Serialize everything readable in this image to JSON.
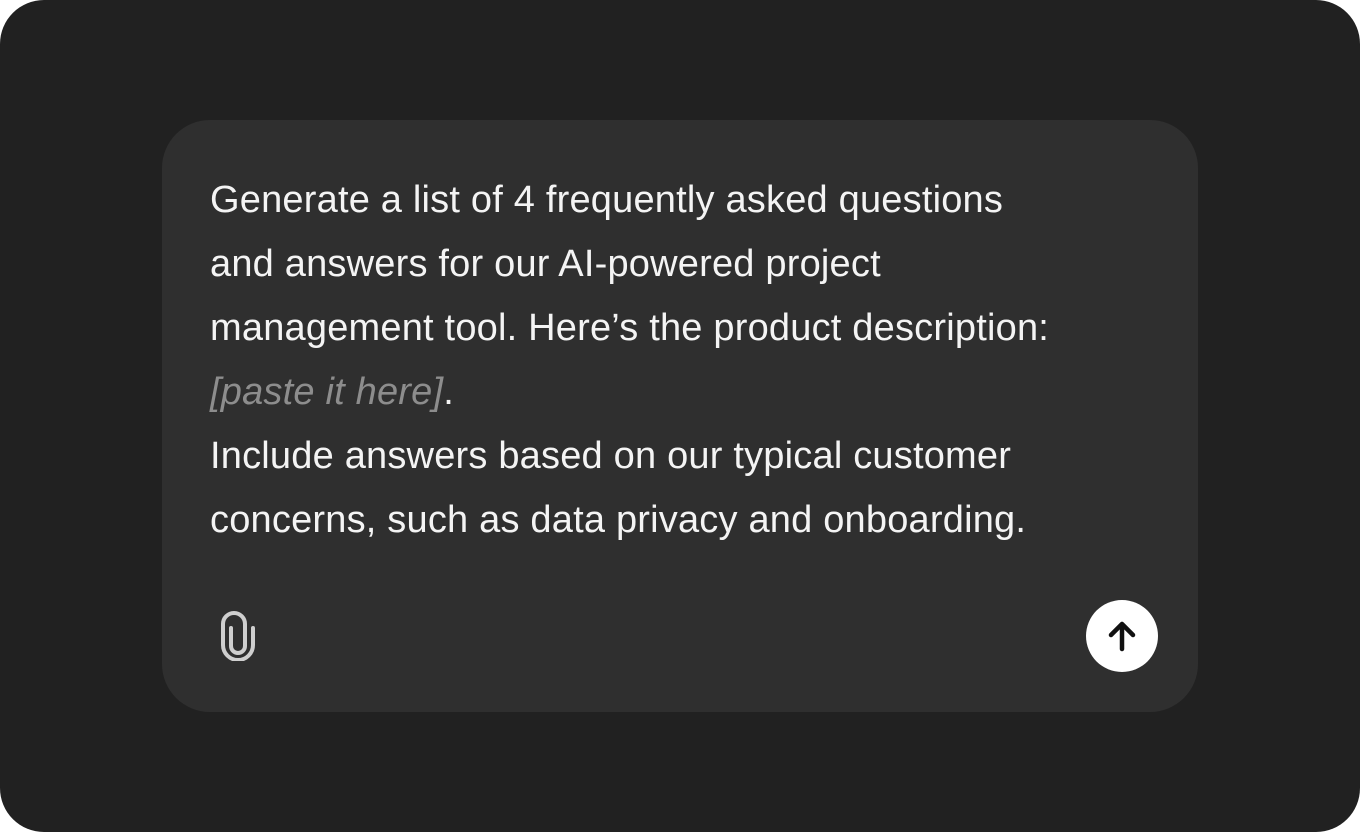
{
  "composer": {
    "prompt": {
      "line1": "Generate a list of 4 frequently asked questions",
      "line2": "and answers for our AI-powered project",
      "line3": "management tool. Here’s the product description:",
      "placeholder": "[paste it here]",
      "placeholder_suffix": ".",
      "line5": "Include answers based on our typical customer",
      "line6": "concerns, such as data privacy and onboarding."
    },
    "attach_icon": "paperclip-icon",
    "send_icon": "arrow-up-icon"
  },
  "colors": {
    "background": "#212121",
    "composer": "#2f2f2f",
    "text": "#f4f4f4",
    "placeholder": "#8d8d8d",
    "send_button": "#ffffff"
  }
}
